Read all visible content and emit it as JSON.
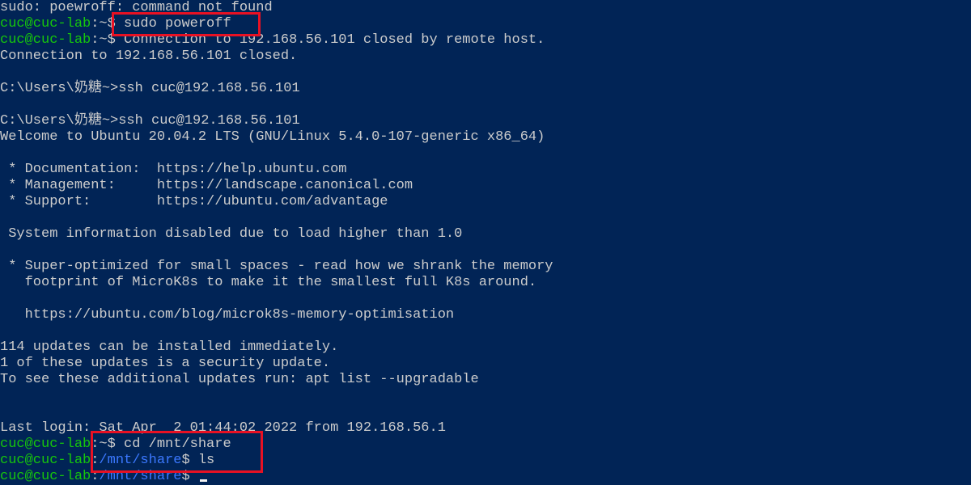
{
  "colors": {
    "background": "#012456",
    "text": "#cccccc",
    "user_host": "#16c60c",
    "path": "#3b78ff",
    "highlight": "#e81123"
  },
  "terminal": {
    "lines": {
      "l1": "sudo: poewroff: command not found",
      "l2_user": "cuc@cuc-lab",
      "l2_sep": ":~$ ",
      "l2_cmd": "sudo poweroff",
      "l3_user": "cuc@cuc-lab",
      "l3_sep": ":~$ ",
      "l3_text": "Connection to 192.168.56.101 closed by remote host.",
      "l4": "Connection to 192.168.56.101 closed.",
      "l6": "C:\\Users\\奶糖~>ssh cuc@192.168.56.101",
      "l8": "C:\\Users\\奶糖~>ssh cuc@192.168.56.101",
      "l9": "Welcome to Ubuntu 20.04.2 LTS (GNU/Linux 5.4.0-107-generic x86_64)",
      "l11": " * Documentation:  https://help.ubuntu.com",
      "l12": " * Management:     https://landscape.canonical.com",
      "l13": " * Support:        https://ubuntu.com/advantage",
      "l15": " System information disabled due to load higher than 1.0",
      "l17": " * Super-optimized for small spaces - read how we shrank the memory",
      "l18": "   footprint of MicroK8s to make it the smallest full K8s around.",
      "l20": "   https://ubuntu.com/blog/microk8s-memory-optimisation",
      "l22": "114 updates can be installed immediately.",
      "l23": "1 of these updates is a security update.",
      "l24": "To see these additional updates run: apt list --upgradable",
      "l27": "Last login: Sat Apr  2 01:44:02 2022 from 192.168.56.1",
      "l28_user": "cuc@cuc-lab",
      "l28_sep": ":~$ ",
      "l28_cmd": "cd /mnt/share",
      "l29_user": "cuc@cuc-lab",
      "l29_sep": ":",
      "l29_path": "/mnt/share",
      "l29_dollar": "$ ",
      "l29_cmd": "ls",
      "l30_user": "cuc@cuc-lab",
      "l30_sep": ":",
      "l30_path": "/mnt/share",
      "l30_dollar": "$ "
    }
  }
}
